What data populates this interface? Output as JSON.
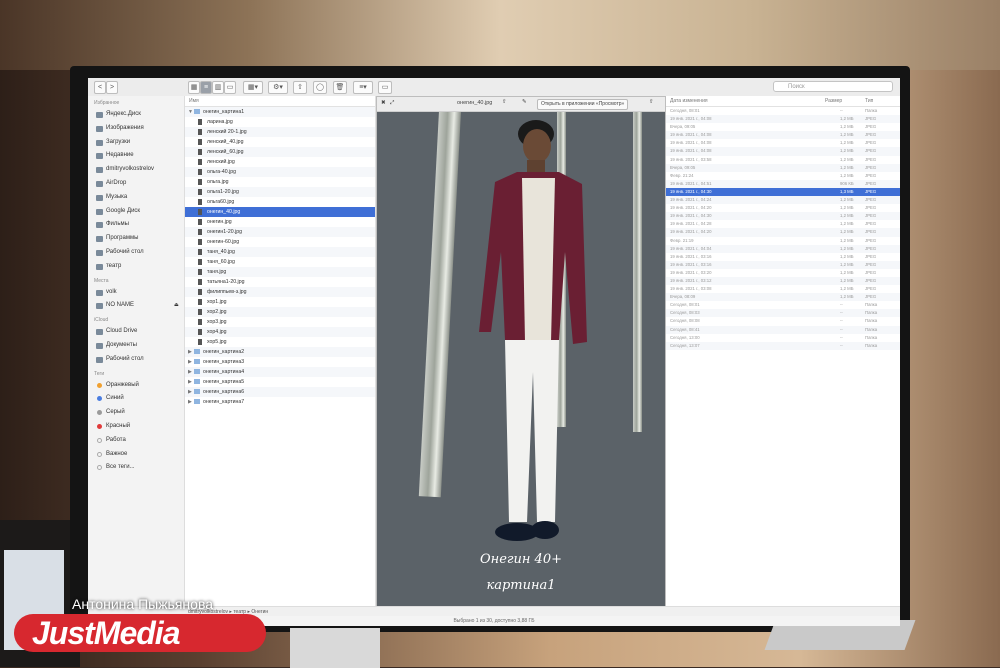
{
  "toolbar": {
    "search_placeholder": "Поиск",
    "back": "<",
    "forward": ">"
  },
  "sidebar": {
    "favorites_header": "Избранное",
    "favorites": [
      "Яндекс.Диск",
      "Изображения",
      "Загрузки",
      "Недавние",
      "dmitryvolkostrelov",
      "AirDrop",
      "Музыка",
      "Google Диск",
      "Фильмы",
      "Программы",
      "Рабочий стол",
      "театр"
    ],
    "places_header": "Места",
    "places": [
      "volk",
      "NO NAME"
    ],
    "icloud_header": "iCloud",
    "icloud": [
      "Cloud Drive",
      "Документы",
      "Рабочий стол"
    ],
    "tags_header": "Теги",
    "tags": [
      {
        "label": "Оранжевый",
        "color": "#f0a030"
      },
      {
        "label": "Синий",
        "color": "#4a7de0"
      },
      {
        "label": "Серый",
        "color": "#9a9a9a"
      },
      {
        "label": "Красный",
        "color": "#e03a3a"
      },
      {
        "label": "Работа",
        "color": "#ffffff"
      },
      {
        "label": "Важное",
        "color": "#ffffff"
      },
      {
        "label": "Все теги...",
        "color": "#ffffff"
      }
    ]
  },
  "files": {
    "header": "Имя",
    "open_folder": "онегин_картина1",
    "items": [
      "ларина.jpg",
      "ленский 20-1.jpg",
      "ленский_40.jpg",
      "ленский_60.jpg",
      "ленский.jpg",
      "ольга-40.jpg",
      "ольга.jpg",
      "ольга1-20.jpg",
      "ольга60.jpg",
      "онегин_40.jpg",
      "онегин.jpg",
      "онегин1-20.jpg",
      "онегин-60.jpg",
      "таня_40.jpg",
      "таня_60.jpg",
      "таня.jpg",
      "татьяна1-20.jpg",
      "филиппьев-з.jpg",
      "хор1.jpg",
      "хор2.jpg",
      "хор3.jpg",
      "хор4.jpg",
      "хор5.jpg"
    ],
    "selected_index": 9,
    "folders": [
      "онегин_картина2",
      "онегин_картина3",
      "онегин_картина4",
      "онегин_картина5",
      "онегин_картина6",
      "онегин_картина7"
    ]
  },
  "preview": {
    "filename": "онегин_40.jpg",
    "open_with": "Открыть в приложении «Просмотр»",
    "caption_line1": "Онегин 40+",
    "caption_line2": "картина1"
  },
  "list": {
    "headers": [
      "Дата изменения",
      "Размер",
      "Тип"
    ],
    "rows": [
      [
        "Сегодня, 08:01",
        "--",
        "Папка"
      ],
      [
        "19 янв. 2021 г., 04:08",
        "1,2 МБ",
        "JPEG"
      ],
      [
        "Вчера, 09:05",
        "1,2 МБ",
        "JPEG"
      ],
      [
        "19 янв. 2021 г., 04:08",
        "1,2 МБ",
        "JPEG"
      ],
      [
        "19 янв. 2021 г., 04:08",
        "1,2 МБ",
        "JPEG"
      ],
      [
        "19 янв. 2021 г., 04:08",
        "1,2 МБ",
        "JPEG"
      ],
      [
        "19 янв. 2021 г., 03:58",
        "1,2 МБ",
        "JPEG"
      ],
      [
        "Вчера, 09:05",
        "1,2 МБ",
        "JPEG"
      ],
      [
        "Февр. 21:24",
        "1,2 МБ",
        "JPEG"
      ],
      [
        "19 янв. 2021 г., 04:51",
        "906 КБ",
        "JPEG"
      ],
      [
        "19 янв. 2021 г., 04:30",
        "1,3 МБ",
        "JPEG"
      ],
      [
        "19 янв. 2021 г., 04:24",
        "1,2 МБ",
        "JPEG"
      ],
      [
        "19 янв. 2021 г., 04:20",
        "1,2 МБ",
        "JPEG"
      ],
      [
        "19 янв. 2021 г., 04:30",
        "1,2 МБ",
        "JPEG"
      ],
      [
        "19 янв. 2021 г., 04:28",
        "1,2 МБ",
        "JPEG"
      ],
      [
        "19 янв. 2021 г., 04:20",
        "1,2 МБ",
        "JPEG"
      ],
      [
        "Февр. 21:19",
        "1,2 МБ",
        "JPEG"
      ],
      [
        "19 янв. 2021 г., 04:04",
        "1,2 МБ",
        "JPEG"
      ],
      [
        "19 янв. 2021 г., 03:16",
        "1,2 МБ",
        "JPEG"
      ],
      [
        "19 янв. 2021 г., 03:16",
        "1,2 МБ",
        "JPEG"
      ],
      [
        "19 янв. 2021 г., 03:20",
        "1,2 МБ",
        "JPEG"
      ],
      [
        "19 янв. 2021 г., 03:12",
        "1,2 МБ",
        "JPEG"
      ],
      [
        "19 янв. 2021 г., 03:08",
        "1,2 МБ",
        "JPEG"
      ],
      [
        "Вчера, 08:09",
        "1,2 МБ",
        "JPEG"
      ],
      [
        "Сегодня, 08:01",
        "--",
        "Папка"
      ],
      [
        "Сегодня, 08:03",
        "--",
        "Папка"
      ],
      [
        "Сегодня, 08:08",
        "--",
        "Папка"
      ],
      [
        "Сегодня, 08:41",
        "--",
        "Папка"
      ],
      [
        "Сегодня, 13:00",
        "--",
        "Папка"
      ],
      [
        "Сегодня, 13:07",
        "--",
        "Папка"
      ]
    ],
    "selected_index": 10
  },
  "pathbar": {
    "segments": [
      "dmitryvolkostrelov",
      "театр",
      "Онегин"
    ]
  },
  "status": {
    "text": "Выбрано 1 из 30, доступно 3,88 ГБ"
  },
  "watermark": {
    "credit": "Антонина Пыжьянова",
    "logo": "JustMedia"
  }
}
